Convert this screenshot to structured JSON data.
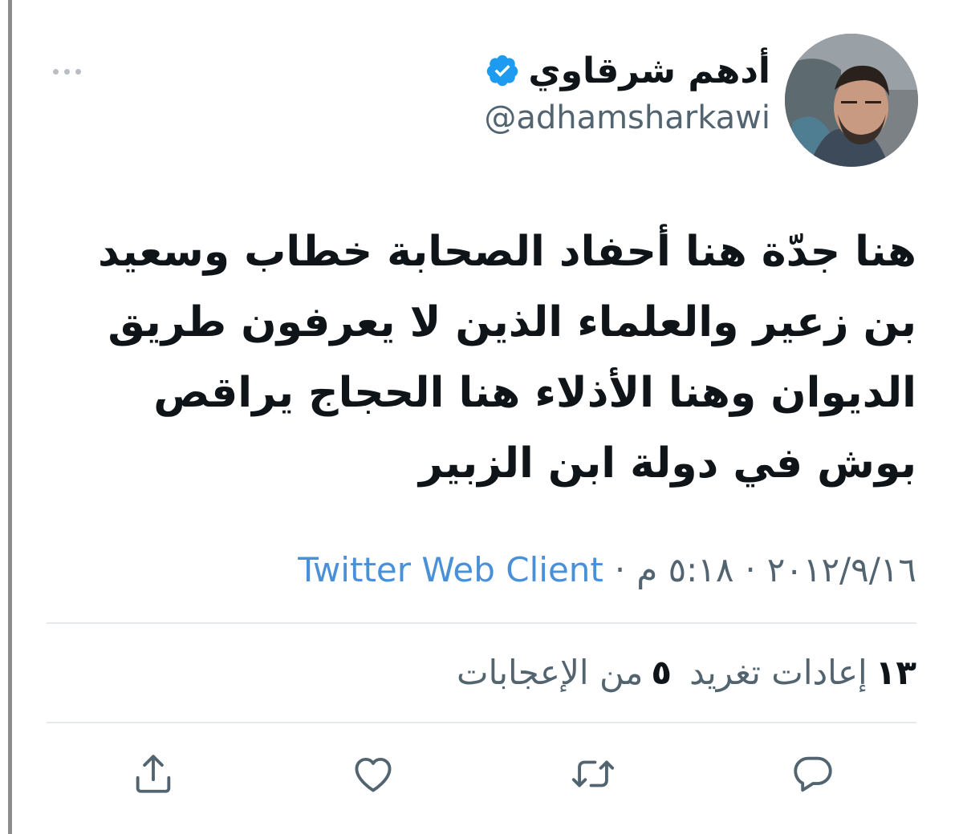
{
  "author": {
    "display_name": "أدهم شرقاوي",
    "handle": "@adhamsharkawi",
    "verified": true,
    "avatar": "profile-photo"
  },
  "tweet": {
    "lines": [
      "هنا جدّة هنا أحفاد الصحابة خطاب وسعيد",
      "بن زعير والعلماء الذين لا يعرفون طريق",
      "الديوان وهنا الأذلاء هنا الحجاج يراقص",
      "بوش في دولة ابن الزبير"
    ]
  },
  "meta": {
    "date": "٢٠١٢/٩/١٦",
    "time": "٥:١٨ م",
    "separator": "·",
    "source": "Twitter Web Client"
  },
  "stats": {
    "retweets_count": "١٣",
    "retweets_label": "إعادات تغريد",
    "likes_count": "٥",
    "likes_label": "من الإعجابات"
  },
  "icons": {
    "more": "more-dots-icon",
    "verified": "verified-badge-icon",
    "reply": "reply-icon",
    "retweet": "retweet-icon",
    "like": "heart-icon",
    "share": "share-icon"
  },
  "colors": {
    "text": "#0f1419",
    "secondary": "#536471",
    "link": "#4a90d9",
    "verified": "#1d9bf0",
    "divider": "#e6e9eb"
  }
}
